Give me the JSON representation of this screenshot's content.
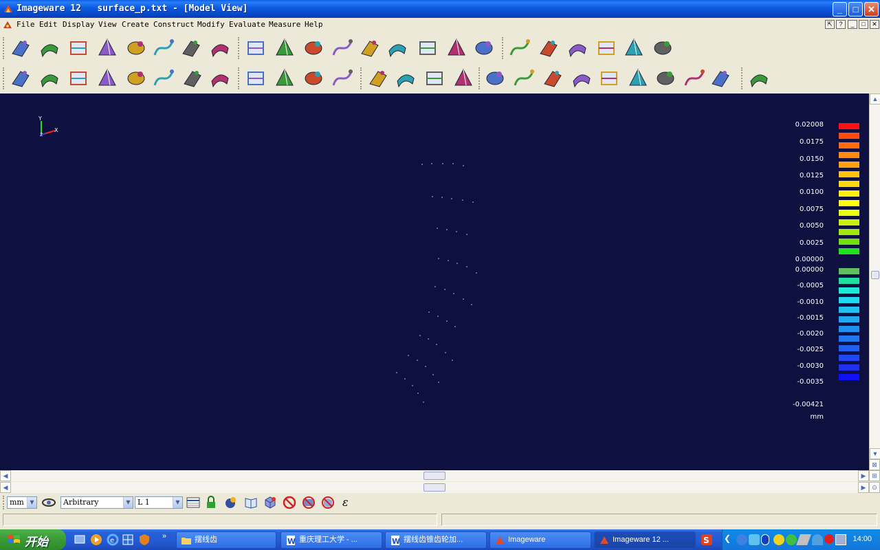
{
  "window": {
    "title": "Imageware 12   surface_p.txt - [Model View]",
    "buttons": {
      "minimize": "_",
      "maximize": "□",
      "close": "✕"
    }
  },
  "menubar": {
    "items": [
      "File",
      "Edit",
      "Display",
      "View",
      "Create",
      "Construct",
      "Modify",
      "Evaluate",
      "Measure",
      "Help"
    ]
  },
  "toolbar1": {
    "icons": [
      "open-file-icon",
      "scan-data-icon",
      "point-cloud-inspect-icon",
      "surface-box-icon",
      "cube-icon",
      "grid-display-icon",
      "pyramid-icon",
      "cup-surface-icon",
      "plane-fit-icon",
      "flat-surface-icon",
      "curved-sheet-icon",
      "swept-surface-icon",
      "blend-surface-icon",
      "offset-surface-icon",
      "extrude-icon",
      "trim-surface-icon",
      "ruled-surface-icon",
      "cone-icon",
      "wireframe-box-icon",
      "mesh-outline-icon",
      "node-network-icon",
      "cylinder-icon",
      "plane-cross-icon",
      "axis-icon"
    ]
  },
  "toolbar2": {
    "icons": [
      "curvature-plot-icon",
      "diagnose-icon",
      "layer-stack-icon",
      "vector-icon",
      "frame-icon",
      "grid-surface-icon",
      "probe-icon",
      "cut-section-icon",
      "cross-section-icon",
      "fold-surface-icon",
      "shaded-sheet-icon",
      "color-map-icon",
      "cloud-points-icon",
      "curve-icon",
      "surface-patch-icon",
      "fan-mesh-icon",
      "mesh-grid-icon",
      "lightning-icon",
      "curve-point-icon",
      "line-points-icon",
      "circle-fit-icon",
      "wave-curve-icon",
      "surface-point-icon",
      "intersect-icon",
      "cancel-icon",
      "palette-icon"
    ]
  },
  "viewport": {
    "triad": {
      "y": "Y",
      "x": "X",
      "z": "Z"
    },
    "background": "#0e1040",
    "point_color": "#c8c8ff"
  },
  "legend": {
    "labels": [
      "0.02008",
      "0.0175",
      "0.0150",
      "0.0125",
      "0.0100",
      "0.0075",
      "0.0050",
      "0.0025",
      "0.00000",
      "0.00000",
      "-0.0005",
      "-0.0010",
      "-0.0015",
      "-0.0020",
      "-0.0025",
      "-0.0030",
      "-0.0035",
      "-0.00421"
    ],
    "unit": "mm",
    "positive_colors": [
      "#ff1010",
      "#ff4a10",
      "#ff6a10",
      "#ff8a10",
      "#ffa010",
      "#ffc010",
      "#ffd810",
      "#ffee10",
      "#ffff10",
      "#e8ff10",
      "#c8f010",
      "#a0e810",
      "#70e010",
      "#20e020"
    ],
    "negative_colors": [
      "#60c060",
      "#20e0a0",
      "#20e8d8",
      "#20d8f0",
      "#20c0f0",
      "#20a8f0",
      "#2090f0",
      "#2078f0",
      "#2060f0",
      "#2048f0",
      "#2030f0",
      "#1010f8"
    ]
  },
  "status": {
    "unit_select": "mm",
    "view_select": "Arbitrary",
    "layer_select": "L 1",
    "epsilon": "ε"
  },
  "taskbar": {
    "start": "开始",
    "tasks": [
      "摆线齿",
      "重庆理工大学 - ...",
      "摆线齿锥齿轮加...",
      "Imageware",
      "Imageware 12    ..."
    ],
    "clock": "14:00"
  }
}
